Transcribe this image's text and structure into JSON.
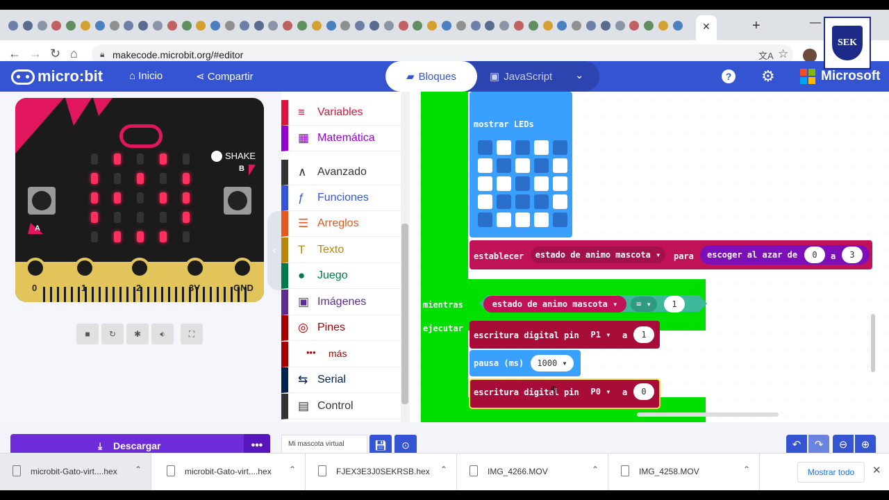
{
  "browser": {
    "url": "makecode.microbit.org/#editor",
    "active_tab_close": "✕",
    "new_tab": "+"
  },
  "header": {
    "logo": "micro:bit",
    "home": "Inicio",
    "share": "Compartir",
    "blocks": "Bloques",
    "javascript": "JavaScript",
    "brand": "Microsoft"
  },
  "school_logo": "SEK",
  "simulator": {
    "shake": "SHAKE",
    "button_a": "A",
    "button_b": "B",
    "pins": [
      "0",
      "1",
      "2",
      "3V",
      "GND"
    ]
  },
  "toolbox": {
    "items": [
      {
        "label": "Variables",
        "color": "#dc143c",
        "icon": "≡"
      },
      {
        "label": "Matemática",
        "color": "#9400d3",
        "icon": "▦"
      },
      {
        "label": "Avanzado",
        "color": "#333333",
        "icon": "∧"
      },
      {
        "label": "Funciones",
        "color": "#3455db",
        "icon": "ƒ"
      },
      {
        "label": "Arreglos",
        "color": "#e65722",
        "icon": "☰"
      },
      {
        "label": "Texto",
        "color": "#b8860b",
        "icon": "T"
      },
      {
        "label": "Juego",
        "color": "#007a4b",
        "icon": "●"
      },
      {
        "label": "Imágenes",
        "color": "#5c2d91",
        "icon": "▣"
      },
      {
        "label": "Pines",
        "color": "#a80000",
        "icon": "◎"
      },
      {
        "label": "más",
        "color": "#a80000",
        "icon": "•••"
      },
      {
        "label": "Serial",
        "color": "#002050",
        "icon": "⇆"
      },
      {
        "label": "Control",
        "color": "#333333",
        "icon": "▤"
      }
    ]
  },
  "blocks": {
    "show_leds": "mostrar LEDs",
    "set": "establecer",
    "set_var": "estado de animo mascota ▾",
    "to": "para",
    "random": "escoger al azar de",
    "random_from": "0",
    "random_and": "a",
    "random_to": "3",
    "while": "mientras",
    "do": "ejecutar",
    "cond_var": "estado de animo mascota ▾",
    "cond_op": "= ▾",
    "cond_val": "1",
    "dw1": "escritura digital pin",
    "dw1_pin": "P1 ▾",
    "dw1_a": "a",
    "dw1_val": "1",
    "pause": "pausa (ms)",
    "pause_val": "1000 ▾",
    "dw2": "escritura digital pin",
    "dw2_pin": "P0 ▾",
    "dw2_a": "a",
    "dw2_val": "0"
  },
  "bottom": {
    "download": "Descargar",
    "download_more": "•••",
    "project_name": "Mi mascota virtual"
  },
  "downloads": {
    "files": [
      "microbit-Gato-virt....hex",
      "microbit-Gato-virt....hex",
      "FJEX3E3J0SEKRSB.hex",
      "IMG_4266.MOV",
      "IMG_4258.MOV"
    ],
    "show_all": "Mostrar todo"
  },
  "colors": {
    "header": "#3454d1",
    "loop_green": "#00e000",
    "leds_blue": "#3aa0ff",
    "variables_red": "#c01256",
    "pins_red": "#a80d3a",
    "logic_teal": "#3cb89a",
    "download_purple": "#6d2bd9"
  }
}
